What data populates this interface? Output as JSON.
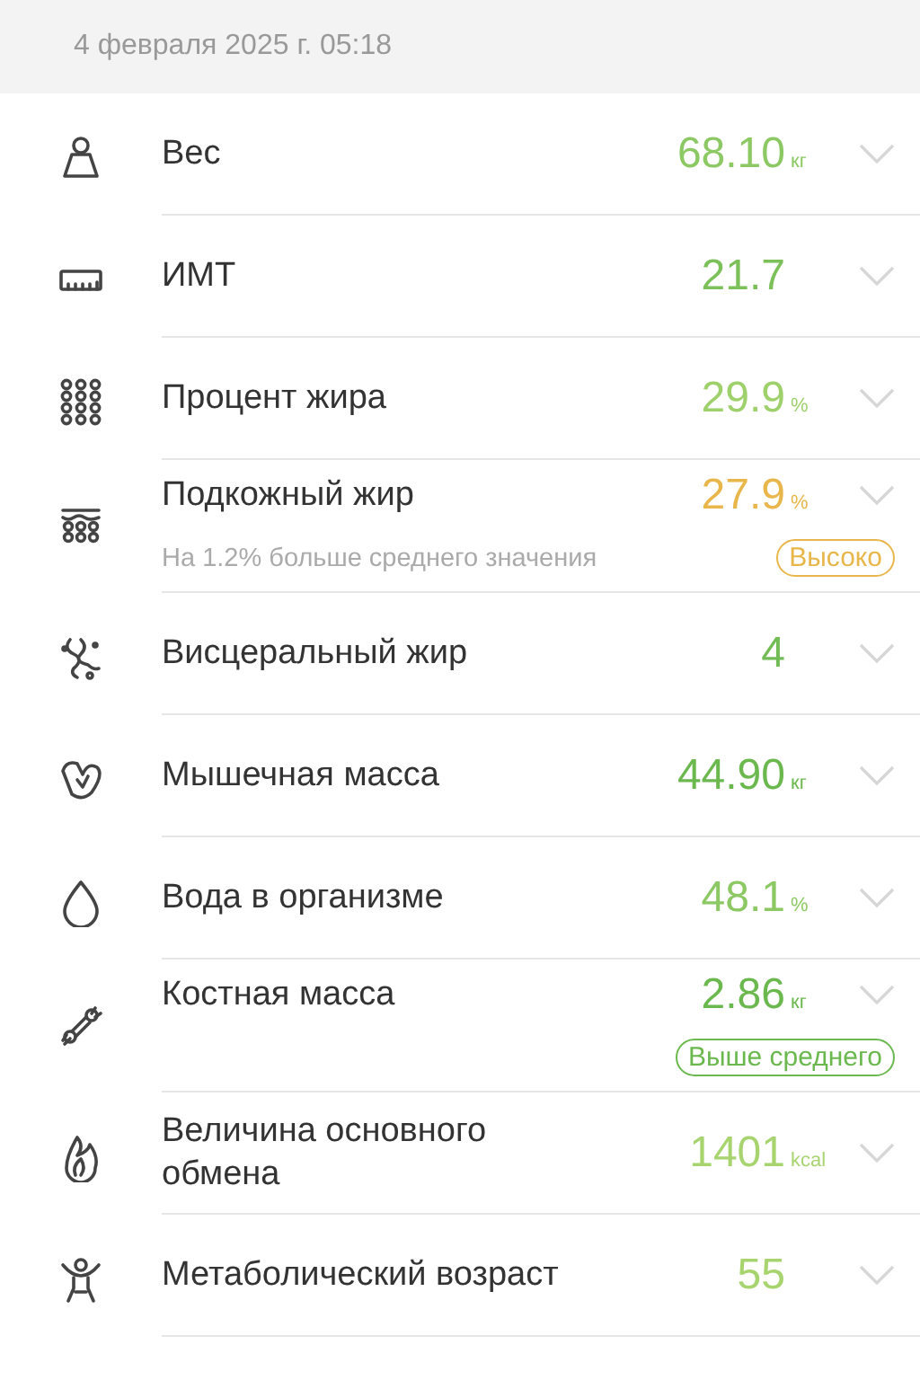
{
  "header": {
    "date": "4 февраля 2025 г. 05:18"
  },
  "metrics": [
    {
      "label": "Вес",
      "value": "68.10",
      "unit": "кг",
      "color": "#8cc863"
    },
    {
      "label": "ИМТ",
      "value": "21.7",
      "color": "#7cc05a"
    },
    {
      "label": "Процент жира",
      "value": "29.9",
      "unit": "%",
      "color": "#9ed06c"
    },
    {
      "label": "Подкожный жир",
      "value": "27.9",
      "unit": "%",
      "color": "#e8b64a",
      "note": "На 1.2% больше среднего значения",
      "badge": {
        "text": "Высоко",
        "color": "#e8b64a"
      }
    },
    {
      "label": "Висцеральный жир",
      "value": "4",
      "color": "#72bc55"
    },
    {
      "label": "Мышечная масса",
      "value": "44.90",
      "unit": "кг",
      "color": "#6bb84f"
    },
    {
      "label": "Вода в организме",
      "value": "48.1",
      "unit": "%",
      "color": "#8cc863"
    },
    {
      "label": "Костная масса",
      "value": "2.86",
      "unit": "кг",
      "color": "#6bb84f",
      "badge": {
        "text": "Выше среднего",
        "color": "#6bb84f"
      }
    },
    {
      "label": "Величина основного обмена",
      "value": "1401",
      "unit": "kcal",
      "color": "#a8d470"
    },
    {
      "label": "Метаболический возраст",
      "value": "55",
      "color": "#a8d470"
    }
  ]
}
